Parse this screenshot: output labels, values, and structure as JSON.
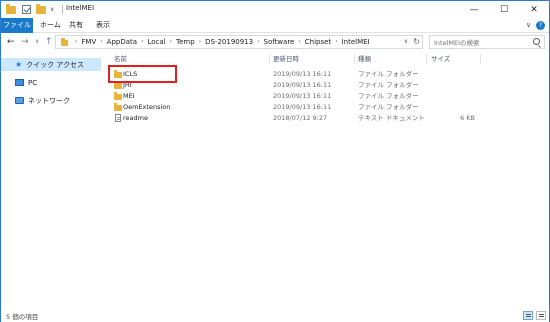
{
  "window": {
    "title": "IntelMEI",
    "controls": {
      "minimize": "—",
      "maximize": "☐",
      "close": "✕"
    }
  },
  "ribbon": {
    "tabs": [
      "ファイル",
      "ホーム",
      "共有",
      "表示"
    ],
    "help": "?",
    "expand": "∨"
  },
  "nav": {
    "back": "←",
    "forward": "→",
    "recent": "∨",
    "up": "↑"
  },
  "address": {
    "crumbs": [
      "FMV",
      "AppData",
      "Local",
      "Temp",
      "DS-20190913",
      "Software",
      "Chipset",
      "IntelMEI"
    ],
    "separator": "›",
    "dropdown": "∨",
    "refresh": "↻"
  },
  "search": {
    "placeholder": "IntelMEIの検索"
  },
  "navpane": {
    "items": [
      "クイック アクセス",
      "PC",
      "ネットワーク"
    ]
  },
  "columns": {
    "name": "名前",
    "date": "更新日時",
    "type": "種類",
    "size": "サイズ"
  },
  "files": [
    {
      "name": "ICLS",
      "date": "2019/09/13 16:11",
      "type": "ファイル フォルダー",
      "size": "",
      "kind": "folder"
    },
    {
      "name": "JHI",
      "date": "2019/09/13 16:11",
      "type": "ファイル フォルダー",
      "size": "",
      "kind": "folder"
    },
    {
      "name": "MEI",
      "date": "2019/09/13 16:11",
      "type": "ファイル フォルダー",
      "size": "",
      "kind": "folder"
    },
    {
      "name": "OemExtension",
      "date": "2019/09/13 16:11",
      "type": "ファイル フォルダー",
      "size": "",
      "kind": "folder"
    },
    {
      "name": "readme",
      "date": "2018/07/12 9:27",
      "type": "テキスト ドキュメント",
      "size": "6 KB",
      "kind": "file"
    }
  ],
  "status": {
    "count": "5 個の項目"
  },
  "colors": {
    "accent": "#1979ca",
    "highlight": "#e02020",
    "folder": "#e8b33a"
  }
}
